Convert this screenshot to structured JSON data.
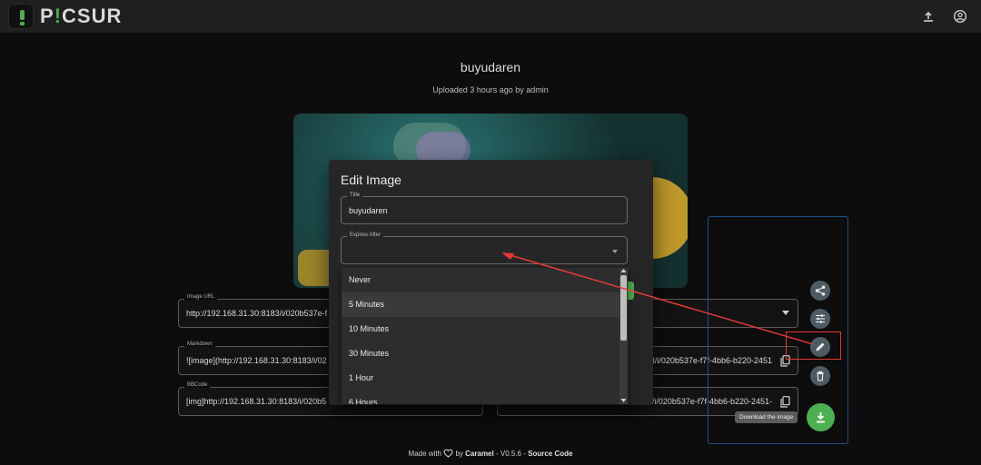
{
  "app": {
    "logo_text_left": "P",
    "logo_text_accent": "!",
    "logo_text_right": "CSUR",
    "brand_color": "#4caf50"
  },
  "header": {
    "icons": [
      "upload-icon",
      "account-icon"
    ]
  },
  "image": {
    "title": "buyudaren",
    "subtitle": "Uploaded 3 hours ago by admin"
  },
  "fields": {
    "image_url": {
      "label": "Image URL",
      "value": "http://192.168.31.30:8183/i/020b537e-f"
    },
    "markdown": {
      "label": "Markdown",
      "value": "![image](http://192.168.31.30:8183/i/02"
    },
    "bbcode": {
      "label": "BBCode",
      "value": "[img]http://192.168.31.30:8183/i/020b5"
    },
    "markdown_right": {
      "value": "183/i/020b537e-f7f-4bb6-b220-2451"
    },
    "bbcode_right": {
      "value": "183/i/020b537e-f7f-4bb6-b220-2451-"
    }
  },
  "dialog": {
    "title": "Edit Image",
    "title_field": {
      "label": "Title",
      "value": "buyudaren"
    },
    "expires_field": {
      "label": "Expires After",
      "value": ""
    }
  },
  "dropdown": {
    "options": [
      "Never",
      "5 Minutes",
      "10 Minutes",
      "30 Minutes",
      "1 Hour",
      "6 Hours"
    ],
    "highlighted_index": 1
  },
  "fab": {
    "tooltip": "Download the image",
    "actions": [
      "share-icon",
      "settings-icon",
      "edit-icon",
      "delete-icon",
      "download-icon"
    ]
  },
  "footer": {
    "made_with": "Made with",
    "by": "by",
    "author": "Caramel",
    "version": "- V0.5.6 -",
    "source": "Source Code"
  }
}
